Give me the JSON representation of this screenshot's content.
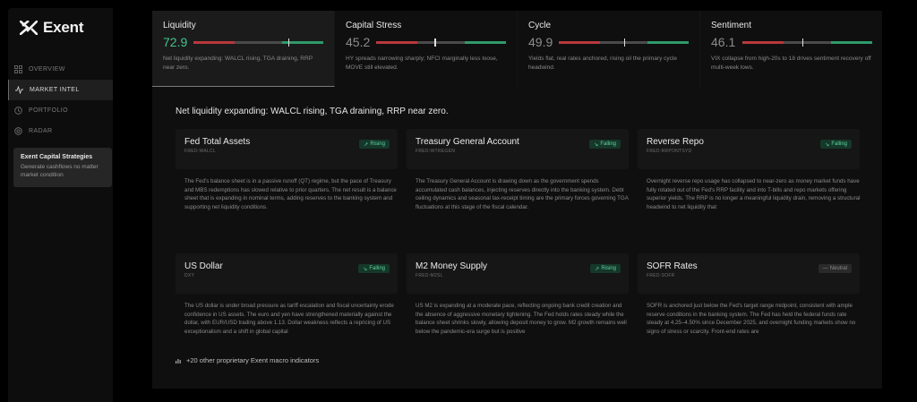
{
  "brand": {
    "name": "Exent"
  },
  "sidebar": {
    "items": [
      {
        "label": "OVERVIEW",
        "icon": "grid-icon"
      },
      {
        "label": "MARKET INTEL",
        "icon": "pulse-icon"
      },
      {
        "label": "PORTFOLIO",
        "icon": "clock-icon"
      },
      {
        "label": "RADAR",
        "icon": "radar-icon"
      }
    ],
    "promo": {
      "title": "Exent Capital Strategies",
      "description": "Generate cashflows no matter market condition"
    }
  },
  "tabs": [
    {
      "title": "Liquidity",
      "value": "72.9",
      "level": 0.73,
      "description": "Net liquidity expanding: WALCL rising, TGA draining, RRP near zero."
    },
    {
      "title": "Capital Stress",
      "value": "45.2",
      "level": 0.45,
      "description": "HY spreads narrowing sharply; NFCI marginally less loose, MOVE still elevated."
    },
    {
      "title": "Cycle",
      "value": "49.9",
      "level": 0.5,
      "description": "Yields flat, real rates anchored, rising oil the primary cycle headwind."
    },
    {
      "title": "Sentiment",
      "value": "46.1",
      "level": 0.46,
      "description": "VIX collapse from high-20s to 18 drives sentiment recovery off multi-week lows."
    }
  ],
  "headline": "Net liquidity expanding: WALCL rising, TGA draining, RRP near zero.",
  "cards": [
    {
      "title": "Fed Total Assets",
      "source": "FRED:WALCL",
      "status": "Rising",
      "status_type": "green",
      "body": "The Fed's balance sheet is in a passive runoff (QT) regime, but the pace of Treasury and MBS redemptions has slowed relative to prior quarters. The net result is a balance sheet that is expanding in nominal terms, adding reserves to the banking system and supporting net liquidity conditions."
    },
    {
      "title": "Treasury General Account",
      "source": "FRED:WTREGEN",
      "status": "Falling",
      "status_type": "green",
      "body": "The Treasury General Account is drawing down as the government spends accumulated cash balances, injecting reserves directly into the banking system. Debt ceiling dynamics and seasonal tax-receipt timing are the primary forces governing TGA fluctuations at this stage of the fiscal calendar."
    },
    {
      "title": "Reverse Repo",
      "source": "FRED:RRPONTSYD",
      "status": "Falling",
      "status_type": "green",
      "body": "Overnight reverse repo usage has collapsed to near-zero as money market funds have fully rotated out of the Fed's RRP facility and into T-bills and repo markets offering superior yields. The RRP is no longer a meaningful liquidity drain, removing a structural headwind to net liquidity that"
    },
    {
      "title": "US Dollar",
      "source": "DXY",
      "status": "Falling",
      "status_type": "green",
      "body": "The US dollar is under broad pressure as tariff escalation and fiscal uncertainty erode confidence in US assets. The euro and yen have strengthened materially against the dollar, with EUR/USD trading above 1.13. Dollar weakness reflects a repricing of US exceptionalism and a shift in global capital"
    },
    {
      "title": "M2 Money Supply",
      "source": "FRED:M2SL",
      "status": "Rising",
      "status_type": "green",
      "body": "US M2 is expanding at a moderate pace, reflecting ongoing bank credit creation and the absence of aggressive monetary tightening. The Fed holds rates steady while the balance sheet shrinks slowly, allowing deposit money to grow. M2 growth remains well below the pandemic-era surge but is positive"
    },
    {
      "title": "SOFR Rates",
      "source": "FRED:SOFR",
      "status": "Neutral",
      "status_type": "neutral",
      "body": "SOFR is anchored just below the Fed's target range midpoint, consistent with ample reserve conditions in the banking system. The Fed has held the federal funds rate steady at 4.25–4.50% since December 2025, and overnight funding markets show no signs of stress or scarcity. Front-end rates are"
    }
  ],
  "more_label": "+20 other proprietary Exent macro indicators",
  "colors": {
    "accent_green": "#43c48c",
    "gauge_red": "#b8383c",
    "gauge_gray": "#4a4a4a",
    "gauge_green": "#2f9a6a"
  }
}
